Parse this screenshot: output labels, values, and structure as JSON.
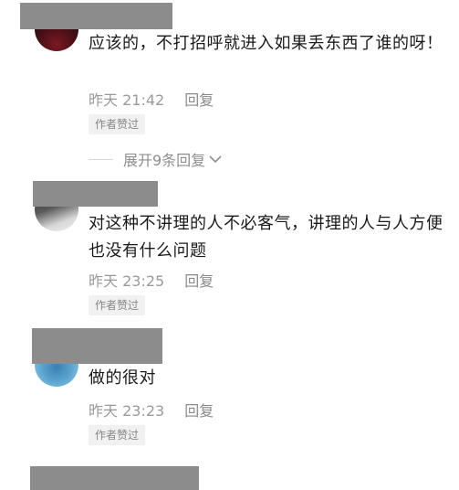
{
  "comments": [
    {
      "text": "应该的，不打招呼就进入如果丢东西了谁的呀！",
      "time": "昨天 21:42",
      "reply_label": "回复",
      "badge": "作者赞过"
    },
    {
      "text": "对这种不讲理的人不必客气，讲理的人与人方便也没有什么问题",
      "time": "昨天 23:25",
      "reply_label": "回复",
      "badge": "作者赞过"
    },
    {
      "text": "做的很对",
      "time": "昨天 23:23",
      "reply_label": "回复",
      "badge": "作者赞过"
    }
  ],
  "expand_replies_label": "展开9条回复",
  "colors": {
    "redaction": "#8c8c8c",
    "text": "#1a1a1a",
    "meta": "#9a9a9a",
    "badge_bg": "#f1f1f1"
  },
  "icons": {
    "expand": "chevron-down-icon"
  }
}
